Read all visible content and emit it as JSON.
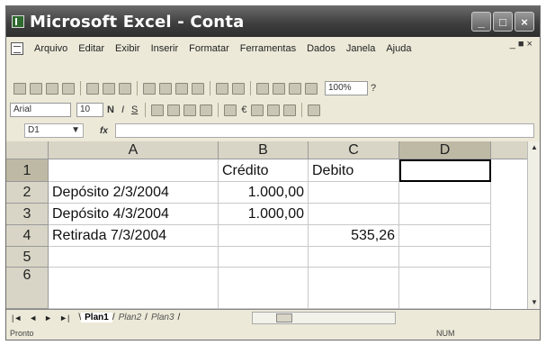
{
  "window": {
    "title": "Microsoft Excel - Conta",
    "btn_min": "_",
    "btn_max": "□",
    "btn_close": "×"
  },
  "menu": {
    "items": [
      "Arquivo",
      "Editar",
      "Exibir",
      "Inserir",
      "Formatar",
      "Ferramentas",
      "Dados",
      "Janela",
      "Ajuda"
    ],
    "doc_controls": "_ ■ ×"
  },
  "toolbar": {
    "zoom": "100%",
    "font_name": "Arial",
    "font_size": "10",
    "bold": "N",
    "italic": "I",
    "underline": "S",
    "currency": "€",
    "help": "?"
  },
  "formula_bar": {
    "name_box": "D1",
    "fx": "fx",
    "formula": ""
  },
  "grid": {
    "columns": [
      "A",
      "B",
      "C",
      "D"
    ],
    "active_column": "D",
    "rows": [
      {
        "num": "1",
        "a": "",
        "b": "Crédito",
        "c": "Debito",
        "d": ""
      },
      {
        "num": "2",
        "a": "Depósito 2/3/2004",
        "b": "1.000,00",
        "c": "",
        "d": ""
      },
      {
        "num": "3",
        "a": "Depósito 4/3/2004",
        "b": "1.000,00",
        "c": "",
        "d": ""
      },
      {
        "num": "4",
        "a": "Retirada 7/3/2004",
        "b": "",
        "c": "535,26",
        "d": ""
      },
      {
        "num": "5",
        "a": "",
        "b": "",
        "c": "",
        "d": ""
      },
      {
        "num": "6",
        "a": "",
        "b": "",
        "c": "",
        "d": ""
      }
    ]
  },
  "sheets": {
    "tabs": [
      "Plan1",
      "Plan2",
      "Plan3"
    ],
    "active": "Plan1"
  },
  "status": {
    "left": "Pronto",
    "right": "NUM"
  }
}
